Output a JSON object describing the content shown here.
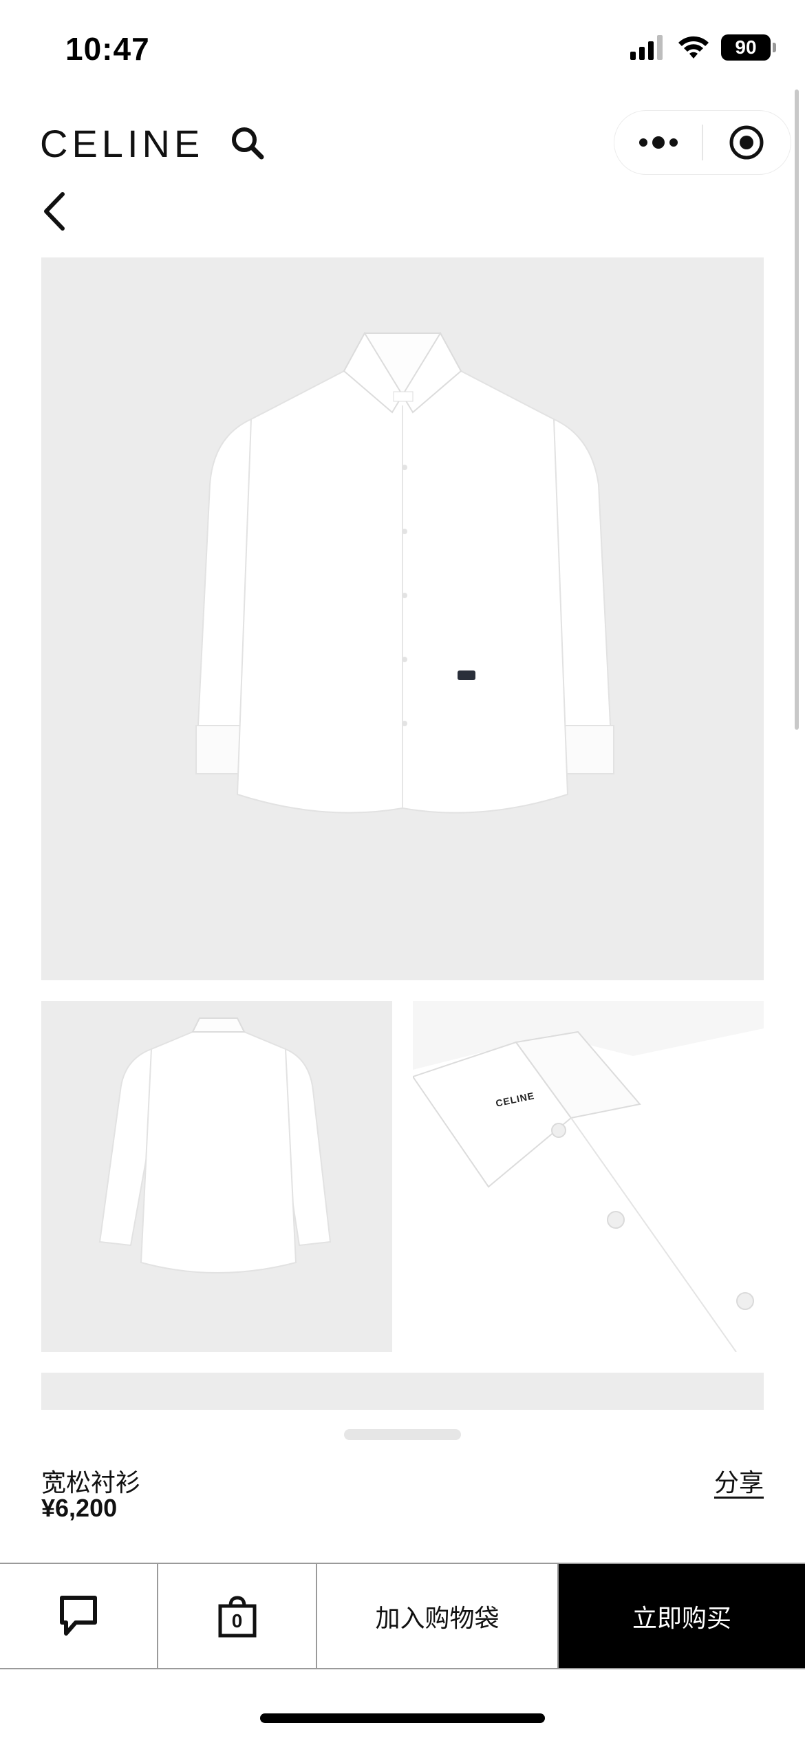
{
  "status_bar": {
    "time": "10:47",
    "battery": "90"
  },
  "header": {
    "logo": "CELINE"
  },
  "gallery": {
    "main_alt": "Loose shirt front",
    "back_alt": "Loose shirt back",
    "detail_alt": "Collar detail",
    "collar_label": "CELINE"
  },
  "product": {
    "name": "宽松衬衫",
    "price": "¥6,200",
    "share_label": "分享"
  },
  "bottom_bar": {
    "bag_count": "0",
    "add_to_bag": "加入购物袋",
    "buy_now": "立即购买"
  },
  "colors": {
    "background": "#ffffff",
    "image_bg": "#ececec",
    "accent": "#000000"
  }
}
